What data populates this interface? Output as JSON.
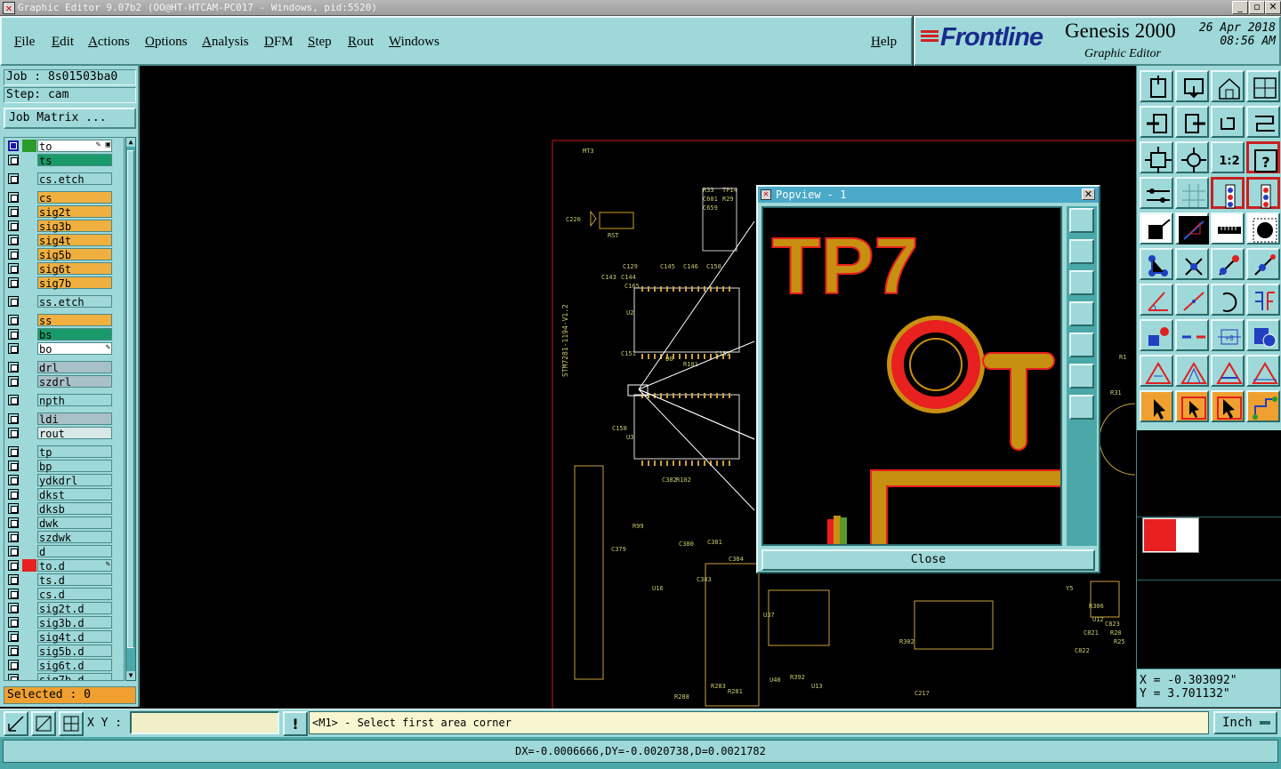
{
  "window": {
    "title": "Graphic Editor 9.07b2 (OO@HT-HTCAM-PC017 - Windows, pid:5520)",
    "min_label": "_",
    "max_label": "▫",
    "close_label": "✕"
  },
  "menu": {
    "items": [
      "File",
      "Edit",
      "Actions",
      "Options",
      "Analysis",
      "DFM",
      "Step",
      "Rout",
      "Windows"
    ],
    "help": "Help"
  },
  "logo": {
    "brand": "Frontline",
    "product": "Genesis 2000",
    "subtitle": "Graphic Editor",
    "date": "26 Apr 2018",
    "time": "08:56 AM"
  },
  "job": {
    "job_label": "Job : 8s01503ba0",
    "step_label": "Step: cam",
    "matrix_button": "Job Matrix ..."
  },
  "layers": [
    {
      "name": "to",
      "color": "#ffffff",
      "swatch": "#2a9a2a",
      "checked": true,
      "mark": "✎ ▣"
    },
    {
      "name": "ts",
      "color": "#1a9a6a",
      "swatch": "",
      "checked": false,
      "mark": ""
    },
    {
      "name": "cs.etch",
      "color": "#9ed8d8",
      "swatch": "",
      "checked": false,
      "mark": ""
    },
    {
      "name": "cs",
      "color": "#f0b040",
      "swatch": "",
      "checked": false,
      "mark": ""
    },
    {
      "name": "sig2t",
      "color": "#f0b040",
      "swatch": "",
      "checked": false,
      "mark": ""
    },
    {
      "name": "sig3b",
      "color": "#f0b040",
      "swatch": "",
      "checked": false,
      "mark": ""
    },
    {
      "name": "sig4t",
      "color": "#f0b040",
      "swatch": "",
      "checked": false,
      "mark": ""
    },
    {
      "name": "sig5b",
      "color": "#f0b040",
      "swatch": "",
      "checked": false,
      "mark": ""
    },
    {
      "name": "sig6t",
      "color": "#f0b040",
      "swatch": "",
      "checked": false,
      "mark": ""
    },
    {
      "name": "sig7b",
      "color": "#f0b040",
      "swatch": "",
      "checked": false,
      "mark": ""
    },
    {
      "name": "ss.etch",
      "color": "#9ed8d8",
      "swatch": "",
      "checked": false,
      "mark": ""
    },
    {
      "name": "ss",
      "color": "#f0b040",
      "swatch": "",
      "checked": false,
      "mark": ""
    },
    {
      "name": "bs",
      "color": "#1a9a6a",
      "swatch": "",
      "checked": false,
      "mark": ""
    },
    {
      "name": "bo",
      "color": "#ffffff",
      "swatch": "",
      "checked": false,
      "mark": "✎"
    },
    {
      "name": "drl",
      "color": "#a8c0c8",
      "swatch": "",
      "checked": false,
      "mark": ""
    },
    {
      "name": "szdrl",
      "color": "#a8c0c8",
      "swatch": "",
      "checked": false,
      "mark": ""
    },
    {
      "name": "npth",
      "color": "#9ed8d8",
      "swatch": "",
      "checked": false,
      "mark": ""
    },
    {
      "name": "ldi",
      "color": "#a8c0c8",
      "swatch": "",
      "checked": false,
      "mark": ""
    },
    {
      "name": "rout",
      "color": "#d8e8e8",
      "swatch": "",
      "checked": false,
      "mark": ""
    },
    {
      "name": "tp",
      "color": "#9ed8d8",
      "swatch": "",
      "checked": false,
      "mark": ""
    },
    {
      "name": "bp",
      "color": "#9ed8d8",
      "swatch": "",
      "checked": false,
      "mark": ""
    },
    {
      "name": "ydkdrl",
      "color": "#9ed8d8",
      "swatch": "",
      "checked": false,
      "mark": ""
    },
    {
      "name": "dkst",
      "color": "#9ed8d8",
      "swatch": "",
      "checked": false,
      "mark": ""
    },
    {
      "name": "dksb",
      "color": "#9ed8d8",
      "swatch": "",
      "checked": false,
      "mark": ""
    },
    {
      "name": "dwk",
      "color": "#9ed8d8",
      "swatch": "",
      "checked": false,
      "mark": ""
    },
    {
      "name": "szdwk",
      "color": "#9ed8d8",
      "swatch": "",
      "checked": false,
      "mark": ""
    },
    {
      "name": "d",
      "color": "#9ed8d8",
      "swatch": "",
      "checked": false,
      "mark": ""
    },
    {
      "name": "to.d",
      "color": "#9ed8d8",
      "swatch": "#e82020",
      "checked": false,
      "mark": "✎"
    },
    {
      "name": "ts.d",
      "color": "#9ed8d8",
      "swatch": "",
      "checked": false,
      "mark": ""
    },
    {
      "name": "cs.d",
      "color": "#9ed8d8",
      "swatch": "",
      "checked": false,
      "mark": ""
    },
    {
      "name": "sig2t.d",
      "color": "#9ed8d8",
      "swatch": "",
      "checked": false,
      "mark": ""
    },
    {
      "name": "sig3b.d",
      "color": "#9ed8d8",
      "swatch": "",
      "checked": false,
      "mark": ""
    },
    {
      "name": "sig4t.d",
      "color": "#9ed8d8",
      "swatch": "",
      "checked": false,
      "mark": ""
    },
    {
      "name": "sig5b.d",
      "color": "#9ed8d8",
      "swatch": "",
      "checked": false,
      "mark": ""
    },
    {
      "name": "sig6t.d",
      "color": "#9ed8d8",
      "swatch": "",
      "checked": false,
      "mark": ""
    },
    {
      "name": "sig7b.d",
      "color": "#9ed8d8",
      "swatch": "",
      "checked": false,
      "mark": ""
    }
  ],
  "selected_label": "Selected : 0",
  "canvas": {
    "board_label": "STM7281-1194-V1.2",
    "labels": [
      "MT3",
      "C220",
      "RST",
      "C129",
      "C143",
      "C144",
      "C145",
      "C146",
      "C150",
      "C151",
      "C152",
      "C158",
      "C165",
      "U2",
      "U3",
      "U6",
      "R101",
      "R102",
      "R99",
      "C382",
      "C380",
      "C379",
      "C381",
      "C384",
      "C383",
      "U16",
      "U37",
      "U40",
      "U13",
      "R392",
      "R302",
      "C217",
      "R288",
      "R283",
      "R281",
      "R306",
      "U12",
      "C821",
      "C822",
      "C823",
      "R20",
      "R25",
      "Y5",
      "L22",
      "R31",
      "R1",
      "R33",
      "TP14",
      "C601",
      "C659",
      "R29"
    ]
  },
  "popview": {
    "title": "Popview - 1",
    "close_button": "Close",
    "text": "TP7"
  },
  "toolbox": {
    "icons": [
      "zoom-home-icon",
      "zoom-save-icon",
      "zoom-house-icon",
      "window-split-icon",
      "pan-left-icon",
      "pan-right-icon",
      "undo-icon",
      "redo-icon",
      "fit-screen-icon",
      "fit-profile-icon",
      "one-to-one-icon",
      "help-query-icon",
      "measure-icon",
      "grid-icon",
      "snap-layer-icon",
      "snap-net-icon",
      "select-feature-icon",
      "select-net-icon",
      "ruler-icon",
      "pad-icon",
      "connect-icon",
      "node-icon",
      "add-line-icon",
      "move-node-icon",
      "angle-icon",
      "line-icon",
      "arc-icon",
      "flip-icon",
      "copy-icon",
      "break-icon",
      "resize-icon",
      "transform-icon",
      "triangle-a-icon",
      "triangle-b-icon",
      "triangle-c-icon",
      "triangle-d-icon",
      "pointer-icon",
      "pointer-box-icon",
      "pointer-select-icon",
      "pointer-route-icon"
    ]
  },
  "coords": {
    "x": "X = -0.303092\"",
    "y": "Y = 3.701132\""
  },
  "bottom": {
    "xy_label": "X Y :",
    "xy_value": "",
    "prompt": "<M1> - Select first area corner",
    "units": "Inch",
    "status": "DX=-0.0006666,DY=-0.0020738,D=0.0021782"
  }
}
